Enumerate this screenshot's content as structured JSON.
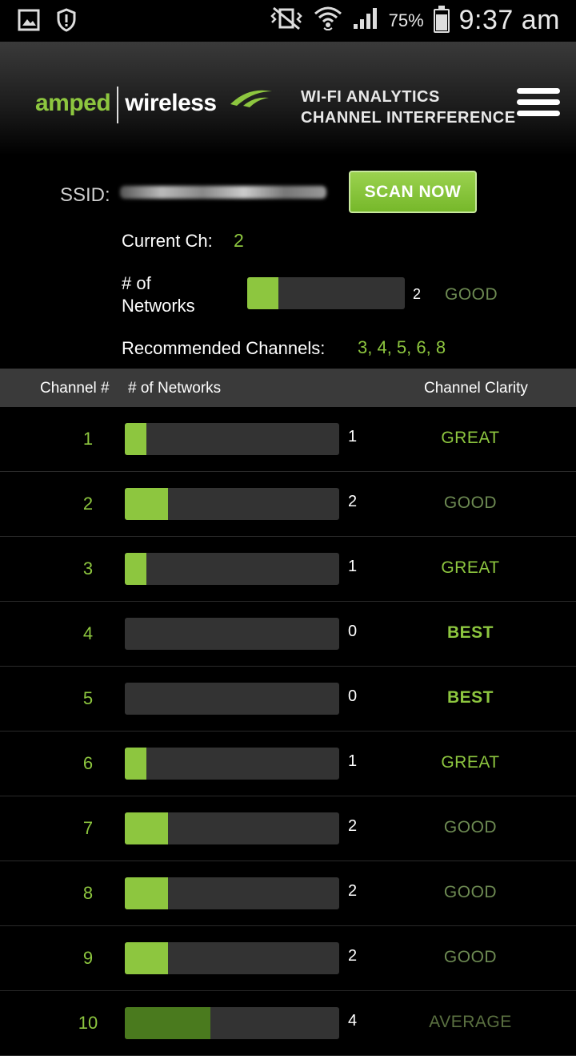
{
  "status_bar": {
    "time": "9:37 am",
    "battery_percent": "75%",
    "battery_level": 0.75,
    "left_icons": [
      "gallery-icon",
      "shield-alert-icon"
    ],
    "right_icons": [
      "vibrate-mute-icon",
      "wifi-icon",
      "signal-icon",
      "battery-icon"
    ]
  },
  "header": {
    "logo_amped": "amped",
    "logo_wireless": "wireless",
    "title_line1": "WI-FI ANALYTICS",
    "title_line2": "CHANNEL INTERFERENCE",
    "menu_icon": "hamburger-menu-icon"
  },
  "summary": {
    "ssid_label": "SSID:",
    "scan_button": "SCAN NOW",
    "current_ch_label": "Current Ch:",
    "current_ch_value": "2",
    "networks_label_line1": "# of",
    "networks_label_line2": "Networks",
    "networks_count": "2",
    "networks_fraction": 0.2,
    "networks_clarity": "GOOD",
    "recommended_label": "Recommended Channels:",
    "recommended_value": "3, 4, 5, 6, 8"
  },
  "table": {
    "headers": [
      "Channel #",
      "# of Networks",
      "Channel Clarity"
    ],
    "rows": [
      {
        "channel": "1",
        "count": "1",
        "fraction": 0.1,
        "clarity": "GREAT",
        "class": "c-great"
      },
      {
        "channel": "2",
        "count": "2",
        "fraction": 0.2,
        "clarity": "GOOD",
        "class": "c-good"
      },
      {
        "channel": "3",
        "count": "1",
        "fraction": 0.1,
        "clarity": "GREAT",
        "class": "c-great"
      },
      {
        "channel": "4",
        "count": "0",
        "fraction": 0.0,
        "clarity": "BEST",
        "class": "c-best"
      },
      {
        "channel": "5",
        "count": "0",
        "fraction": 0.0,
        "clarity": "BEST",
        "class": "c-best"
      },
      {
        "channel": "6",
        "count": "1",
        "fraction": 0.1,
        "clarity": "GREAT",
        "class": "c-great"
      },
      {
        "channel": "7",
        "count": "2",
        "fraction": 0.2,
        "clarity": "GOOD",
        "class": "c-good"
      },
      {
        "channel": "8",
        "count": "2",
        "fraction": 0.2,
        "clarity": "GOOD",
        "class": "c-good"
      },
      {
        "channel": "9",
        "count": "2",
        "fraction": 0.2,
        "clarity": "GOOD",
        "class": "c-good"
      },
      {
        "channel": "10",
        "count": "4",
        "fraction": 0.4,
        "clarity": "AVERAGE",
        "class": "c-average"
      }
    ]
  },
  "colors": {
    "accent": "#8dc63f",
    "good": "#6d8a52",
    "bar_track": "#333333",
    "table_header_bg": "#3a3a3a"
  }
}
